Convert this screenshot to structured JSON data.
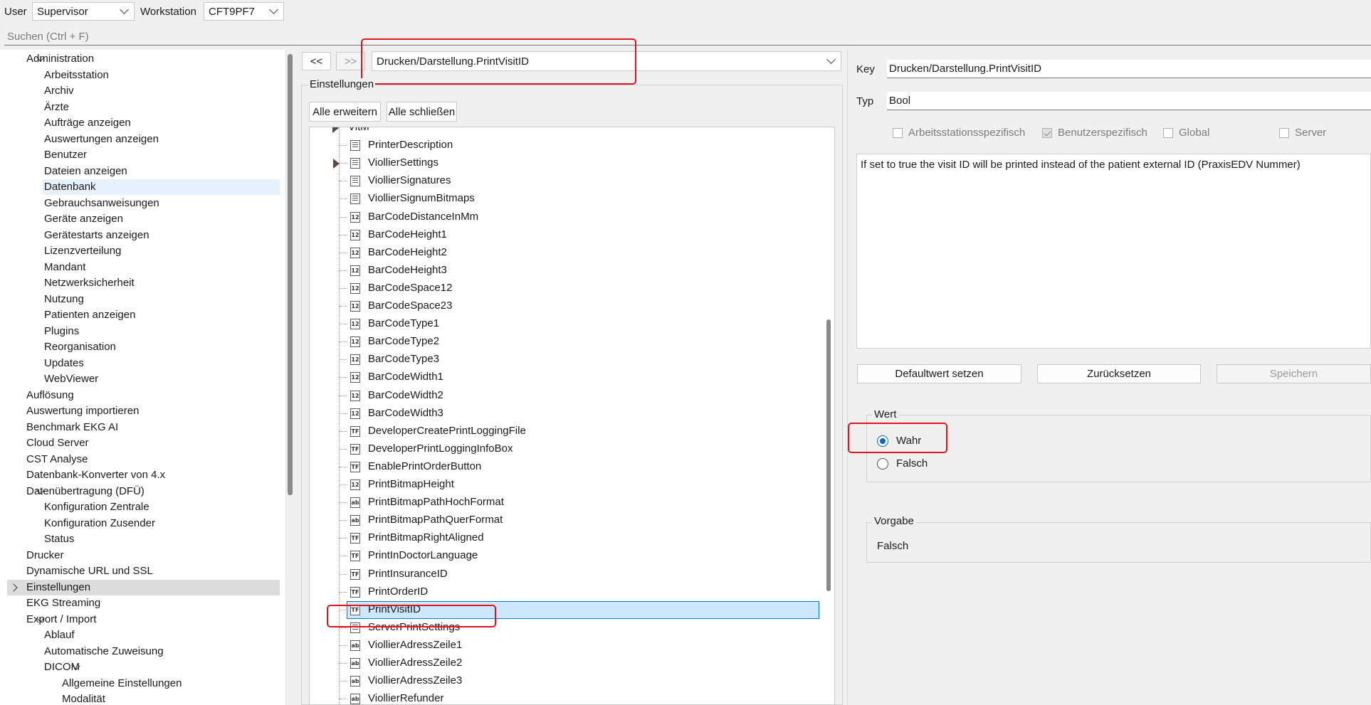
{
  "topbar": {
    "user_label": "User",
    "user_value": "Supervisor",
    "workstation_label": "Workstation",
    "workstation_value": "CFT9PF7"
  },
  "search": {
    "placeholder": "Suchen (Ctrl + F)"
  },
  "left_tree": [
    {
      "label": "Administration",
      "level": 0,
      "expander": "down"
    },
    {
      "label": "Arbeitsstation",
      "level": 1
    },
    {
      "label": "Archiv",
      "level": 1
    },
    {
      "label": "Ärzte",
      "level": 1
    },
    {
      "label": "Aufträge anzeigen",
      "level": 1
    },
    {
      "label": "Auswertungen anzeigen",
      "level": 1
    },
    {
      "label": "Benutzer",
      "level": 1
    },
    {
      "label": "Dateien anzeigen",
      "level": 1
    },
    {
      "label": "Datenbank",
      "level": 1,
      "state": "hover"
    },
    {
      "label": "Gebrauchsanweisungen",
      "level": 1
    },
    {
      "label": "Geräte anzeigen",
      "level": 1
    },
    {
      "label": "Gerätestarts anzeigen",
      "level": 1
    },
    {
      "label": "Lizenzverteilung",
      "level": 1
    },
    {
      "label": "Mandant",
      "level": 1
    },
    {
      "label": "Netzwerksicherheit",
      "level": 1
    },
    {
      "label": "Nutzung",
      "level": 1
    },
    {
      "label": "Patienten anzeigen",
      "level": 1
    },
    {
      "label": "Plugins",
      "level": 1
    },
    {
      "label": "Reorganisation",
      "level": 1
    },
    {
      "label": "Updates",
      "level": 1
    },
    {
      "label": "WebViewer",
      "level": 1
    },
    {
      "label": "Auflösung",
      "level": 0
    },
    {
      "label": "Auswertung importieren",
      "level": 0
    },
    {
      "label": "Benchmark EKG AI",
      "level": 0
    },
    {
      "label": "Cloud Server",
      "level": 0
    },
    {
      "label": "CST Analyse",
      "level": 0
    },
    {
      "label": "Datenbank-Konverter von 4.x",
      "level": 0
    },
    {
      "label": "Datenübertragung (DFÜ)",
      "level": 0,
      "expander": "down"
    },
    {
      "label": "Konfiguration Zentrale",
      "level": 1
    },
    {
      "label": "Konfiguration Zusender",
      "level": 1
    },
    {
      "label": "Status",
      "level": 1
    },
    {
      "label": "Drucker",
      "level": 0
    },
    {
      "label": "Dynamische URL und SSL",
      "level": 0
    },
    {
      "label": "Einstellungen",
      "level": 0,
      "expander": "right",
      "state": "selected"
    },
    {
      "label": "EKG Streaming",
      "level": 0
    },
    {
      "label": "Export / Import",
      "level": 0,
      "expander": "down"
    },
    {
      "label": "Ablauf",
      "level": 1
    },
    {
      "label": "Automatische Zuweisung",
      "level": 1
    },
    {
      "label": "DICOM",
      "level": 1,
      "expander": "down"
    },
    {
      "label": "Allgemeine Einstellungen",
      "level": 2
    },
    {
      "label": "Modalität",
      "level": 2
    }
  ],
  "nav": {
    "back_label": "<<",
    "forward_label": ">>",
    "path_value": "Drucken/Darstellung.PrintVisitID"
  },
  "settings": {
    "group_label": "Einstellungen",
    "expand_all": "Alle erweitern",
    "collapse_all": "Alle schließen"
  },
  "settings_tree": [
    {
      "label": "VitM",
      "icon": "none",
      "expander": true
    },
    {
      "label": "PrinterDescription",
      "icon": "doc"
    },
    {
      "label": "ViollierSettings",
      "icon": "doc",
      "expander": true
    },
    {
      "label": "ViollierSignatures",
      "icon": "doc"
    },
    {
      "label": "ViollierSignumBitmaps",
      "icon": "doc"
    },
    {
      "label": "BarCodeDistanceInMm",
      "icon": "12"
    },
    {
      "label": "BarCodeHeight1",
      "icon": "12"
    },
    {
      "label": "BarCodeHeight2",
      "icon": "12"
    },
    {
      "label": "BarCodeHeight3",
      "icon": "12"
    },
    {
      "label": "BarCodeSpace12",
      "icon": "12"
    },
    {
      "label": "BarCodeSpace23",
      "icon": "12"
    },
    {
      "label": "BarCodeType1",
      "icon": "12"
    },
    {
      "label": "BarCodeType2",
      "icon": "12"
    },
    {
      "label": "BarCodeType3",
      "icon": "12"
    },
    {
      "label": "BarCodeWidth1",
      "icon": "12"
    },
    {
      "label": "BarCodeWidth2",
      "icon": "12"
    },
    {
      "label": "BarCodeWidth3",
      "icon": "12"
    },
    {
      "label": "DeveloperCreatePrintLoggingFile",
      "icon": "TF"
    },
    {
      "label": "DeveloperPrintLoggingInfoBox",
      "icon": "TF"
    },
    {
      "label": "EnablePrintOrderButton",
      "icon": "TF"
    },
    {
      "label": "PrintBitmapHeight",
      "icon": "12"
    },
    {
      "label": "PrintBitmapPathHochFormat",
      "icon": "ab"
    },
    {
      "label": "PrintBitmapPathQuerFormat",
      "icon": "ab"
    },
    {
      "label": "PrintBitmapRightAligned",
      "icon": "TF"
    },
    {
      "label": "PrintInDoctorLanguage",
      "icon": "TF"
    },
    {
      "label": "PrintInsuranceID",
      "icon": "TF"
    },
    {
      "label": "PrintOrderID",
      "icon": "TF"
    },
    {
      "label": "PrintVisitID",
      "icon": "TF",
      "selected": true
    },
    {
      "label": "ServerPrintSettings",
      "icon": "doc"
    },
    {
      "label": "ViollierAdressZeile1",
      "icon": "ab"
    },
    {
      "label": "ViollierAdressZeile2",
      "icon": "ab"
    },
    {
      "label": "ViollierAdressZeile3",
      "icon": "ab"
    },
    {
      "label": "ViollierRefunder",
      "icon": "ab"
    }
  ],
  "details": {
    "key_label": "Key",
    "key_value": "Drucken/Darstellung.PrintVisitID",
    "type_label": "Typ",
    "type_value": "Bool",
    "checkboxes": [
      {
        "label": "Arbeitsstationsspezifisch",
        "checked": false
      },
      {
        "label": "Benutzerspezifisch",
        "checked": true
      },
      {
        "label": "Global",
        "checked": false
      },
      {
        "label": "Server",
        "checked": false
      }
    ],
    "description": "If set to true the visit ID will be printed instead of the patient external ID (PraxisEDV Nummer)",
    "default_button": "Defaultwert setzen",
    "reset_button": "Zurücksetzen",
    "save_button": "Speichern",
    "value_group": "Wert",
    "value_true": "Wahr",
    "value_false": "Falsch",
    "selected_value": "Wahr",
    "default_group": "Vorgabe",
    "default_value": "Falsch"
  },
  "colors": {
    "accent": "#0067c0",
    "selection": "#cce8ff",
    "highlight": "#e0141e"
  }
}
